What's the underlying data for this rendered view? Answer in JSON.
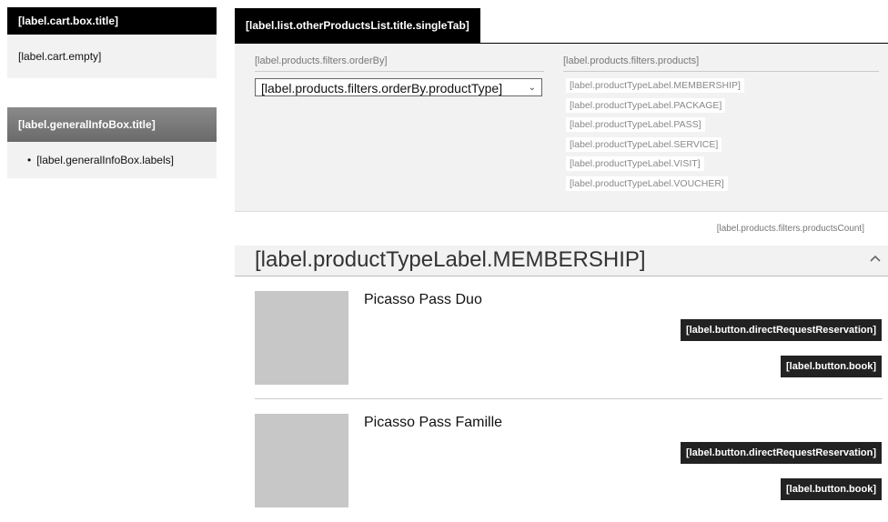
{
  "cart": {
    "title": "[label.cart.box.title]",
    "empty": "[label.cart.empty]"
  },
  "general_info": {
    "title": "[label.generalInfoBox.title]",
    "labels": "[label.generalInfoBox.labels]"
  },
  "tabs": {
    "single": "[label.list.otherProductsList.title.singleTab]"
  },
  "filters": {
    "order_by_label": "[label.products.filters.orderBy]",
    "order_by_value": "[label.products.filters.orderBy.productType]",
    "products_label": "[label.products.filters.products]",
    "product_types": [
      "[label.productTypeLabel.MEMBERSHIP]",
      "[label.productTypeLabel.PACKAGE]",
      "[label.productTypeLabel.PASS]",
      "[label.productTypeLabel.SERVICE]",
      "[label.productTypeLabel.VISIT]",
      "[label.productTypeLabel.VOUCHER]"
    ],
    "products_count": "[label.products.filters.productsCount]"
  },
  "category": {
    "title": "[label.productTypeLabel.MEMBERSHIP]"
  },
  "products": [
    {
      "name": "Picasso Pass Duo",
      "request_label": "[label.button.directRequestReservation]",
      "book_label": "[label.button.book]"
    },
    {
      "name": "Picasso Pass Famille",
      "request_label": "[label.button.directRequestReservation]",
      "book_label": "[label.button.book]"
    }
  ]
}
